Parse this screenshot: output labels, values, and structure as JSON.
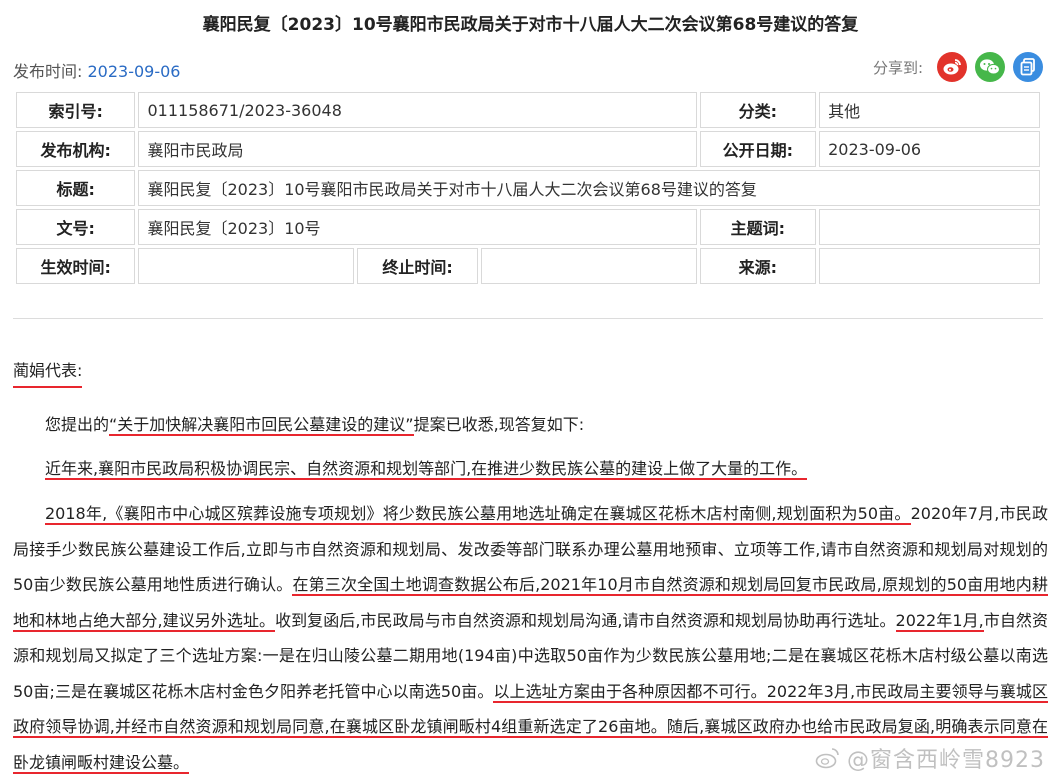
{
  "title": "襄阳民复〔2023〕10号襄阳市民政局关于对市十八届人大二次会议第68号建议的答复",
  "publish": {
    "label": "发布时间:",
    "date": "2023-09-06"
  },
  "share": {
    "label": "分享到:",
    "icons": [
      "weibo-icon",
      "wechat-icon",
      "copy-icon"
    ]
  },
  "meta": {
    "index_label": "索引号:",
    "index_value": "011158671/2023-36048",
    "category_label": "分类:",
    "category_value": "其他",
    "publisher_label": "发布机构:",
    "publisher_value": "襄阳市民政局",
    "public_date_label": "公开日期:",
    "public_date_value": "2023-09-06",
    "title_label": "标题:",
    "title_value": "襄阳民复〔2023〕10号襄阳市民政局关于对市十八届人大二次会议第68号建议的答复",
    "docno_label": "文号:",
    "docno_value": "襄阳民复〔2023〕10号",
    "subject_label": "主题词:",
    "subject_value": "",
    "effective_label": "生效时间:",
    "effective_value": "",
    "expiry_label": "终止时间:",
    "expiry_value": "",
    "source_label": "来源:",
    "source_value": ""
  },
  "letter": {
    "salutation": "蔺娟代表:",
    "p1_a": "您提出的",
    "p1_b": "“关于加快解决襄阳市回民公墓建设的建议”",
    "p1_c": "提案已收悉,现答复如下:",
    "p2": "近年来,襄阳市民政局积极协调民宗、自然资源和规划等部门,在推进少数民族公墓的建设上做了大量的工作。",
    "p3_s1": "2018年,《襄阳市中心城区殡葬设施专项规划》将少数民族公墓用地选址确定在襄城区花栎木店村南侧,规划面积为50亩。",
    "p3_s2": "2020年7月,市民政局接手少数民族公墓建设工作后,立即与市自然资源和规划局、发改委等部门联系办理公墓用地预审、立项等工作,请市自然资源和规划局对规划的50亩少数民族公墓用地性质进行确认。",
    "p3_s3": "在第三次全国土地调查数据公布后,2021年10月市自然资源和规划局回复市民政局,原规划的50亩用地内耕地和林地占绝大部分,建议另外选址。",
    "p3_s4": "收到复函后,市民政局与市自然资源和规划局沟通,请市自然资源和规划局协助再行选址。",
    "p3_s5": "2022年1月,",
    "p3_s6": "市自然资源和规划局又拟定了三个选址方案:一是在归山陵公墓二期用地(194亩)中选取50亩作为少数民族公墓用地;二是在襄城区花栎木店村级公墓以南选50亩;三是在襄城区花栎木店村金色夕阳养老托管中心以南选50亩。",
    "p3_s7": "以上选址方案由于各种原因都不可行。",
    "p3_s8": "2022年3月,市民政局主要领导与襄城区政府领导协调,并经市自然资源和规划局同意,在襄城区卧龙镇闸畈村4组重新选定了26亩地。",
    "p3_s9": "随后,襄城区政府办也给市民政局复函,明确表示同意在卧龙镇闸畈村建设公墓。"
  },
  "watermark": "@窗含西岭雪8923",
  "colors": {
    "link": "#2a6bc4",
    "underline": "#e8262e"
  }
}
